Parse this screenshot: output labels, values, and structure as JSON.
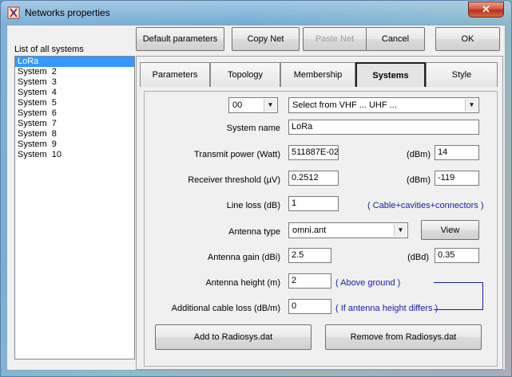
{
  "window": {
    "title": "Networks properties",
    "close_symbol": "✕"
  },
  "toolbar": {
    "default_parameters": "Default parameters",
    "copy_net": "Copy Net",
    "paste_net": "Paste Net",
    "cancel": "Cancel",
    "ok": "OK"
  },
  "systems_list": {
    "label": "List of all systems",
    "items": [
      "LoRa",
      "System  2",
      "System  3",
      "System  4",
      "System  5",
      "System  6",
      "System  7",
      "System  8",
      "System  9",
      "System  10"
    ],
    "selected_index": 0
  },
  "tabs": [
    {
      "label": "Parameters",
      "active": false
    },
    {
      "label": "Topology",
      "active": false
    },
    {
      "label": "Membership",
      "active": false
    },
    {
      "label": "Systems",
      "active": true
    },
    {
      "label": "Style",
      "active": false
    }
  ],
  "systems_panel": {
    "system_number": "00",
    "preset_select": "Select from VHF ... UHF ...",
    "system_name_label": "System name",
    "system_name": "LoRa",
    "tx_power_label": "Transmit power (Watt)",
    "tx_power_watt": "511887E-02",
    "dbm_label": "(dBm)",
    "tx_power_dbm": "14",
    "rx_threshold_label": "Receiver threshold (µV)",
    "rx_threshold_uv": "0.2512",
    "rx_threshold_dbm": "-119",
    "line_loss_label": "Line loss (dB)",
    "line_loss": "1",
    "line_loss_hint": "( Cable+cavities+connectors )",
    "antenna_type_label": "Antenna type",
    "antenna_type": "omni.ant",
    "view_button": "View",
    "antenna_gain_label": "Antenna gain (dBi)",
    "antenna_gain_dbi": "2.5",
    "dbd_label": "(dBd)",
    "antenna_gain_dbd": "0.35",
    "antenna_height_label": "Antenna height (m)",
    "antenna_height": "2",
    "antenna_height_hint": "( Above ground )",
    "cable_loss_label": "Additional cable loss (dB/m)",
    "cable_loss": "0",
    "cable_loss_hint": "( If antenna height differs )",
    "add_button": "Add to Radiosys.dat",
    "remove_button": "Remove from Radiosys.dat"
  }
}
